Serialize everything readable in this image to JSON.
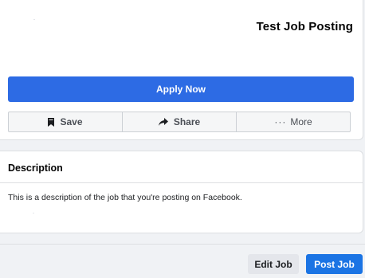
{
  "job": {
    "title": "Test Job Posting",
    "apply_label": "Apply Now"
  },
  "actions": {
    "save_label": "Save",
    "share_label": "Share",
    "more_label": "More",
    "more_prefix": "···"
  },
  "description": {
    "heading": "Description",
    "text": "This is a description of the job that you're posting on Facebook."
  },
  "footer": {
    "edit_label": "Edit Job",
    "post_label": "Post Job"
  },
  "icons": {
    "save": "bookmark-icon",
    "share": "share-arrow-icon",
    "more": "ellipsis-icon"
  },
  "colors": {
    "apply_button": "#2d6be4",
    "post_button": "#1b74e4",
    "edit_button": "#e4e6eb",
    "background": "#f0f2f5"
  }
}
